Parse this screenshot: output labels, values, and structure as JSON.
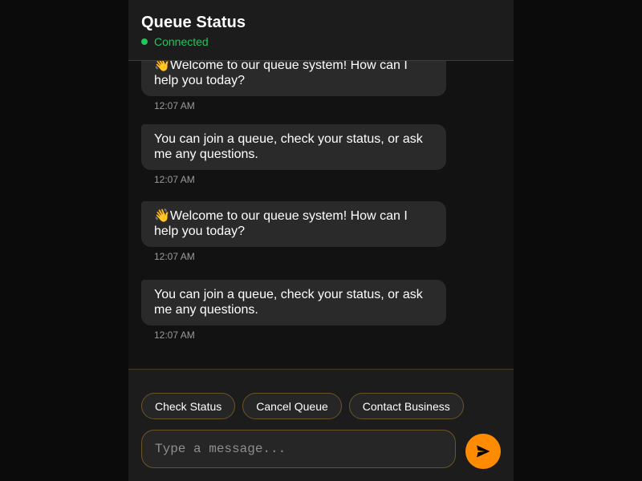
{
  "header": {
    "title": "Queue Status",
    "status": "Connected"
  },
  "messages": [
    {
      "emoji": "👋",
      "text": "Welcome to our queue system! How can I help you today?",
      "time": "12:07 AM"
    },
    {
      "emoji": "",
      "text": "You can join a queue, check your status, or ask me any questions.",
      "time": "12:07 AM"
    },
    {
      "emoji": "👋",
      "text": "Welcome to our queue system! How can I help you today?",
      "time": "12:07 AM"
    },
    {
      "emoji": "",
      "text": "You can join a queue, check your status, or ask me any questions.",
      "time": "12:07 AM"
    }
  ],
  "quick_actions": {
    "check_status": "Check Status",
    "cancel_queue": "Cancel Queue",
    "contact_business": "Contact Business"
  },
  "composer": {
    "placeholder": "Type a message..."
  },
  "icons": {
    "send": "send-icon",
    "status": "status-dot-icon"
  },
  "colors": {
    "accent": "#ff8c00",
    "status_green": "#22c55e",
    "bubble": "#2a2a2a",
    "panel": "#1c1c1c"
  }
}
